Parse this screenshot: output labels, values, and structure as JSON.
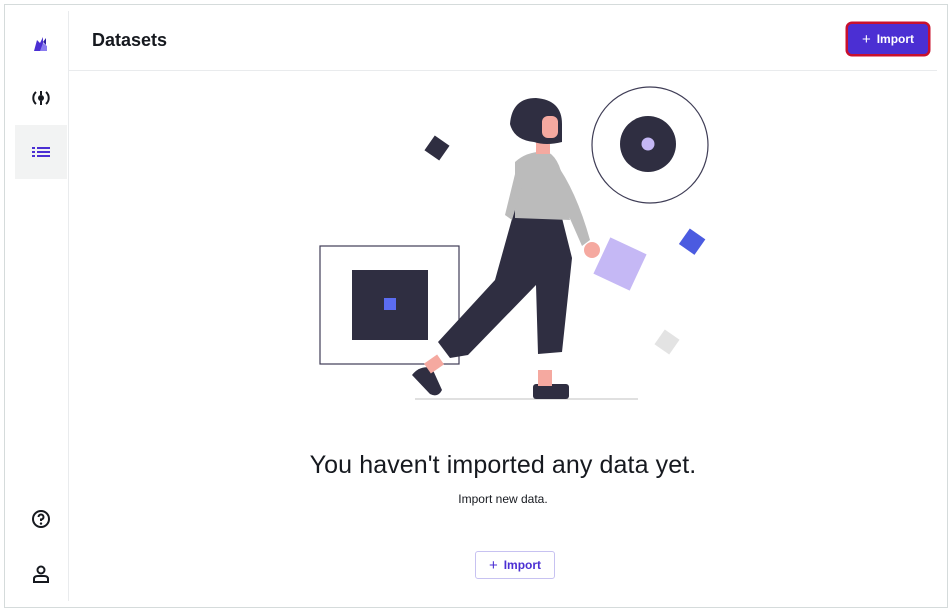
{
  "header": {
    "title": "Datasets",
    "import_label": "Import",
    "import_icon": "plus-icon"
  },
  "sidebar": {
    "items": [
      {
        "name": "logo",
        "icon": "app-logo-icon"
      },
      {
        "name": "models",
        "icon": "model-icon"
      },
      {
        "name": "datasets",
        "icon": "list-icon",
        "active": true
      },
      {
        "name": "help",
        "icon": "help-icon"
      },
      {
        "name": "account",
        "icon": "user-icon"
      }
    ]
  },
  "empty_state": {
    "title": "You haven't imported any data yet.",
    "subtitle": "Import new data.",
    "button_label": "Import",
    "button_icon": "plus-icon"
  },
  "colors": {
    "accent": "#4b2fd3",
    "highlight_border": "#c8102e",
    "illustration_dark": "#2f2e41",
    "illustration_lavender": "#c5b8f5"
  }
}
